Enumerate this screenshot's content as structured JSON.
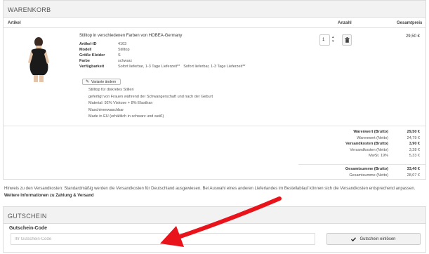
{
  "cart": {
    "title": "WARENKORB",
    "columns": {
      "article": "Artikel",
      "quantity": "Anzahl",
      "total": "Gesamtpreis"
    },
    "item": {
      "title": "Stilltop in verschiedenen Farben von HOBEA-Germany",
      "attributes": [
        {
          "key": "Artikel-ID",
          "value": "4103",
          "value2": ""
        },
        {
          "key": "Modell",
          "value": "Stilltop",
          "value2": ""
        },
        {
          "key": "Größe Kleider",
          "value": "S",
          "value2": ""
        },
        {
          "key": "Farbe",
          "value": "schwarz",
          "value2": ""
        },
        {
          "key": "Verfügbarkeit",
          "value": "Sofort lieferbar, 1-3 Tage Lieferzeit**",
          "value2": "Sofort lieferbar, 1-3 Tage Lieferzeit**"
        }
      ],
      "variant_button": "Variante ändern",
      "description": [
        "Stilltop für diskretes Stillen",
        "gefertigt von Frauen während der Schwangerschaft und nach der Geburt",
        "Material: 92% Viskose + 8% Elasthan",
        "Maschinenwaschbar",
        "Made in EU (erhältlich in schwarz und weiß)"
      ],
      "quantity": "1",
      "price": "29,50 €"
    },
    "summary": [
      {
        "label": "Warenwert (Brutto)",
        "value": "29,50 €",
        "bold": true
      },
      {
        "label": "Warenwert (Netto)",
        "value": "24,79 €",
        "bold": false
      },
      {
        "label": "Versandkosten (Brutto)",
        "value": "3,90 €",
        "bold": true
      },
      {
        "label": "Versandkosten (Netto)",
        "value": "3,28 €",
        "bold": false
      },
      {
        "label": "MwSt. 19%",
        "value": "5,33 €",
        "bold": false
      }
    ],
    "totals": [
      {
        "label": "Gesamtsumme (Brutto)",
        "value": "33,40 €",
        "bold": true
      },
      {
        "label": "Gesamtsumme (Netto)",
        "value": "28,07 €",
        "bold": false
      }
    ]
  },
  "hint": {
    "text": "Hinweis zu den Versandkosten: Standardmäßig werden die Versandkosten für Deutschland ausgewiesen. Bei Auswahl eines anderen Lieferlandes im Bestellablauf können sich die Versandkosten entsprechend anpassen.",
    "link": "Weitere Informationen zu Zahlung & Versand"
  },
  "voucher": {
    "title": "GUTSCHEIN",
    "label": "Gutschein-Code",
    "placeholder": "Ihr Gutschein-Code",
    "button": "Gutschein einlösen"
  },
  "icons": {
    "pencil": "pencil-icon",
    "trash": "trash-icon",
    "check": "check-icon",
    "annotation": "red-arrow"
  },
  "colors": {
    "annotation": "#e8131b",
    "panel_header": "#f2f2f2"
  }
}
